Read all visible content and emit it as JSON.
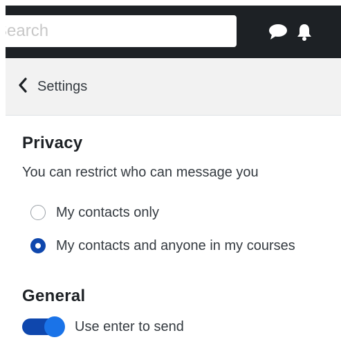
{
  "navbar": {
    "search_placeholder": "Search",
    "messages_icon": "chat-bubble-icon",
    "notifications_icon": "bell-icon"
  },
  "header": {
    "back_label": "Settings"
  },
  "privacy": {
    "title": "Privacy",
    "description": "You can restrict who can message you",
    "options": [
      {
        "label": "My contacts only",
        "checked": false
      },
      {
        "label": "My contacts and anyone in my courses",
        "checked": true
      }
    ]
  },
  "general": {
    "title": "General",
    "enter_to_send_label": "Use enter to send",
    "enter_to_send_on": true
  },
  "colors": {
    "navbar": "#1d2125",
    "accent": "#0f47ad",
    "toggle_knob": "#1a73e8"
  }
}
